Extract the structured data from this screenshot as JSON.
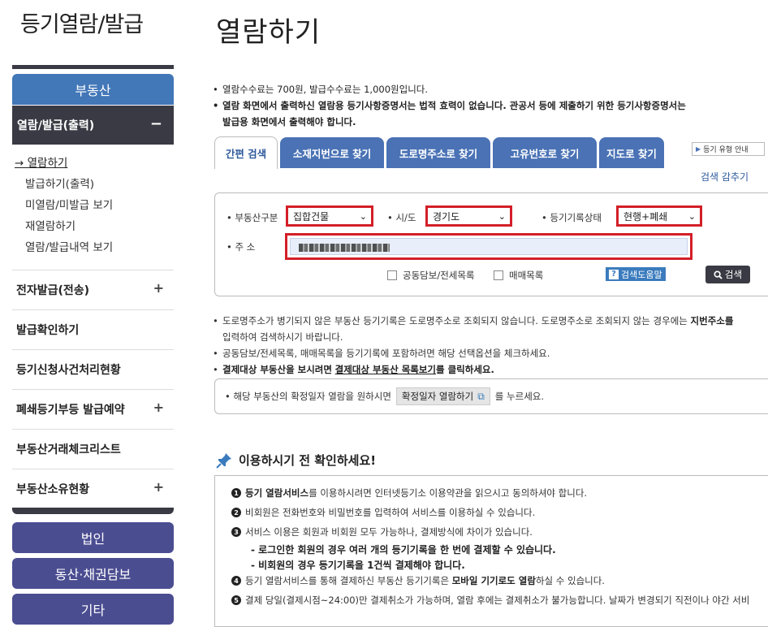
{
  "sidebar": {
    "title": "등기열람/발급",
    "realestate_label": "부동산",
    "active_section": "열람/발급(출력)",
    "active_toggle": "−",
    "sub_items": [
      "→ 열람하기",
      "발급하기(출력)",
      "미열람/미발급 보기",
      "재열람하기",
      "열람/발급내역 보기"
    ],
    "rows": [
      {
        "label": "전자발급(전송)",
        "toggle": "+"
      },
      {
        "label": "발급확인하기",
        "toggle": ""
      },
      {
        "label": "등기신청사건처리현황",
        "toggle": ""
      },
      {
        "label": "폐쇄등기부등 발급예약",
        "toggle": "+"
      },
      {
        "label": "부동산거래체크리스트",
        "toggle": ""
      },
      {
        "label": "부동산소유현황",
        "toggle": "+"
      }
    ],
    "bottom_buttons": [
      "법인",
      "동산·채권담보",
      "기타"
    ]
  },
  "main": {
    "title": "열람하기",
    "notices": [
      "열람수수료는 700원, 발급수수료는 1,000원입니다.",
      "열람 화면에서 출력하신 열람용 등기사항증명서는 법적 효력이 없습니다. 관공서 등에 제출하기 위한 등기사항증명서는",
      "발급용 화면에서 출력해야 합니다."
    ],
    "tabs": [
      "간편 검색",
      "소재지번으로 찾기",
      "도로명주소로 찾기",
      "고유번호로 찾기",
      "지도로 찾기"
    ],
    "tab_help": "등기 유형 안내",
    "search_fold": "검색 감추기",
    "search": {
      "property_type_label": "• 부동산구분",
      "property_type_value": "집합건물",
      "region_label": "• 시/도",
      "region_value": "경기도",
      "record_status_label": "• 등기기록상태",
      "record_status_value": "현행+폐쇄",
      "address_label": "• 주 소",
      "check_mortgage": "공동담보/전세목록",
      "check_trade": "매매목록",
      "help_label": "검색도움말",
      "search_button": "검색"
    },
    "notes": {
      "n1": "도로명주소가 병기되지 않은 부동산 등기기록은 도로명주소로 조회되지 않습니다. 도로명주소로 조회되지 않는 경우에는",
      "n1_bold": "지번주소를",
      "n1b": "입력하여 검색하시기 바랍니다.",
      "n2": "공동담보/전세목록, 매매목록을 등기기록에 포함하려면 해당 선택옵션을 체크하세요.",
      "n3_pre": "결제대상 부동산을 보시려면",
      "n3_link": "결제대상 부동산 목록보기",
      "n3_post": "를 클릭하세요."
    },
    "confirm": {
      "pre": "• 해당 부동산의 확정일자 열람을 원하시면",
      "button": "확정일자 열람하기",
      "post": "를 누르세요."
    },
    "check_title": "이용하시기 전 확인하세요!",
    "check_items": {
      "c1_bold": "등기 열람서비스",
      "c1": "를 이용하시려면 인터넷등기소 이용약관을 읽으시고 동의하셔야 합니다.",
      "c2": "비회원은 전화번호와 비밀번호를 입력하여 서비스를 이용하실 수 있습니다.",
      "c3": "서비스 이용은 회원과 비회원 모두 가능하나, 결제방식에 차이가 있습니다.",
      "c3a": "- 로그인한 회원의 경우 여러 개의 등기기록을 한 번에 결제할 수 있습니다.",
      "c3b": "- 비회원의 경우 등기기록을 1건씩 결제해야 합니다.",
      "c4": "등기 열람서비스를 통해 결제하신 부동산 등기기록은",
      "c4_bold": "모바일 기기로도 열람",
      "c4_post": "하실 수 있습니다.",
      "c5": "결제 당일(결제시점~24:00)만 결제취소가 가능하며, 열람 후에는 결제취소가 불가능합니다. 날짜가 변경되기 직전이나 야간 서비"
    }
  }
}
